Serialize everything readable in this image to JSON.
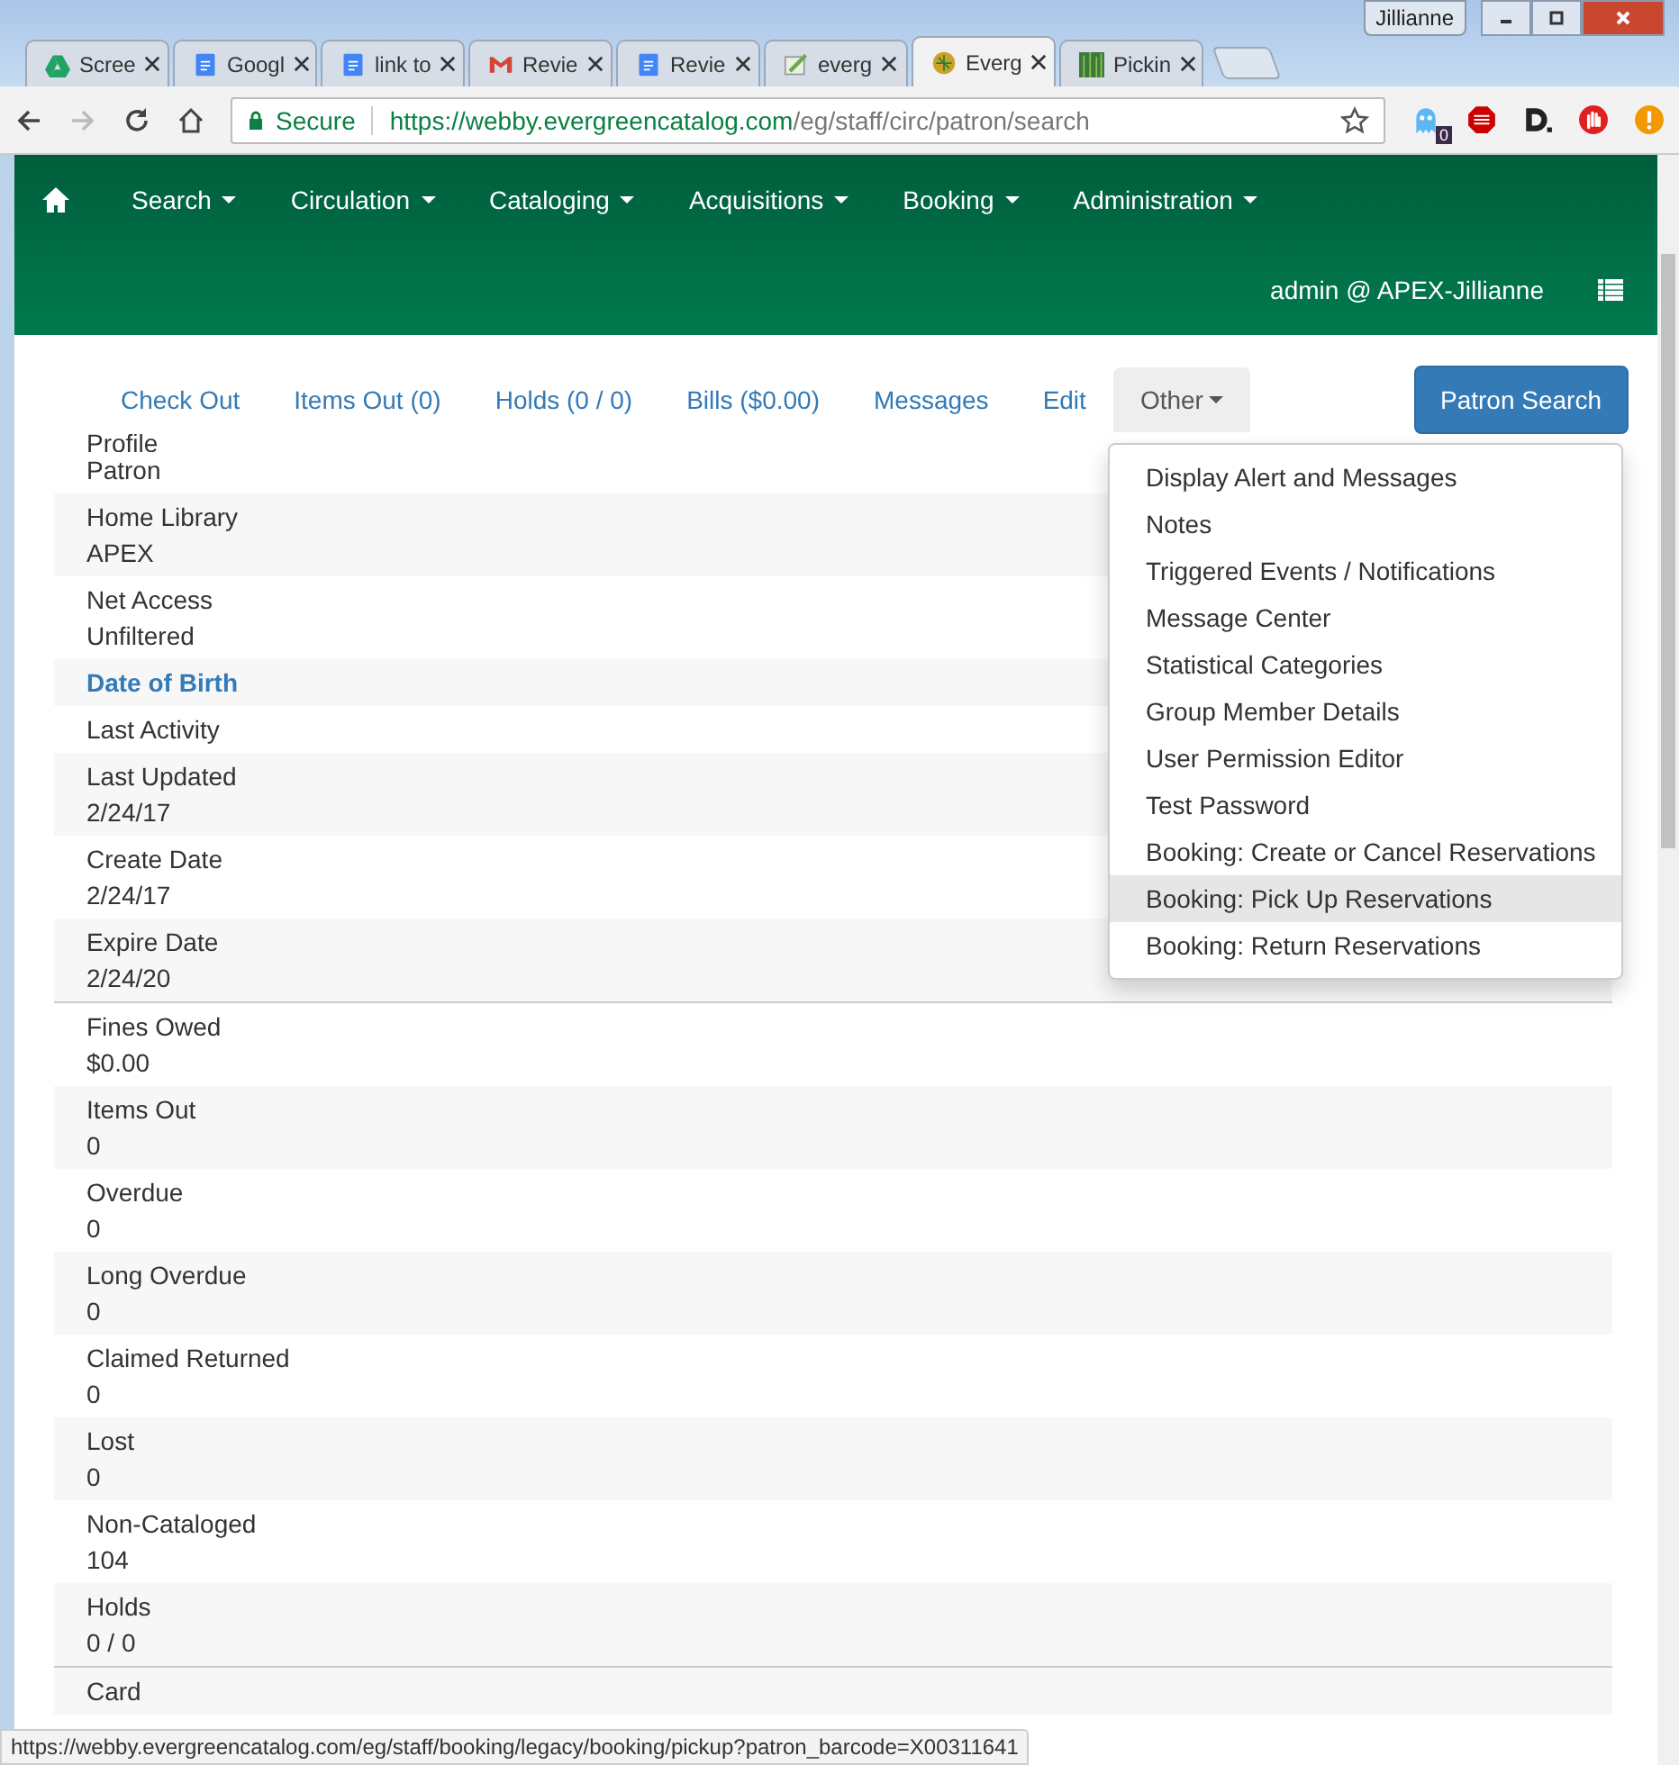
{
  "browser": {
    "profile": "Jillianne",
    "tabs": [
      {
        "title": "Scree",
        "selected": false
      },
      {
        "title": "Googl",
        "selected": false
      },
      {
        "title": "link to",
        "selected": false
      },
      {
        "title": "Revie",
        "selected": false
      },
      {
        "title": "Revie",
        "selected": false
      },
      {
        "title": "everg",
        "selected": false
      },
      {
        "title": "Everg",
        "selected": true
      },
      {
        "title": "Pickin",
        "selected": false
      }
    ],
    "security": "Secure",
    "url_host": "https://webby.evergreencatalog.com",
    "url_path": "/eg/staff/circ/patron/search",
    "extension_badge": "0"
  },
  "nav": {
    "items": [
      "Search",
      "Circulation",
      "Cataloging",
      "Acquisitions",
      "Booking",
      "Administration"
    ],
    "user": "admin @ APEX-Jillianne"
  },
  "patron_tabs": [
    {
      "label": "Check Out",
      "selected": false
    },
    {
      "label": "Items Out (0)",
      "selected": false
    },
    {
      "label": "Holds (0 / 0)",
      "selected": false
    },
    {
      "label": "Bills ($0.00)",
      "selected": false
    },
    {
      "label": "Messages",
      "selected": false
    },
    {
      "label": "Edit",
      "selected": false
    },
    {
      "label": "Other",
      "selected": true,
      "kind": "dropdown"
    }
  ],
  "search_button": "Patron Search",
  "summary_groups": [
    [
      {
        "label": "Profile",
        "value": "Patron",
        "kind": "field"
      },
      {
        "label": "Home Library",
        "value": "APEX",
        "kind": "field"
      },
      {
        "label": "Net Access",
        "value": "Unfiltered",
        "kind": "field"
      },
      {
        "label": "Date of Birth",
        "kind": "link"
      },
      {
        "label": "Last Activity",
        "kind": "field"
      },
      {
        "label": "Last Updated",
        "value": "2/24/17",
        "kind": "field"
      },
      {
        "label": "Create Date",
        "value": "2/24/17",
        "kind": "field"
      },
      {
        "label": "Expire Date",
        "value": "2/24/20",
        "kind": "field"
      }
    ],
    [
      {
        "label": "Fines Owed",
        "value": "$0.00",
        "kind": "field"
      },
      {
        "label": "Items Out",
        "value": "0",
        "kind": "field"
      },
      {
        "label": "Overdue",
        "value": "0",
        "kind": "field"
      },
      {
        "label": "Long Overdue",
        "value": "0",
        "kind": "field"
      },
      {
        "label": "Claimed Returned",
        "value": "0",
        "kind": "field"
      },
      {
        "label": "Lost",
        "value": "0",
        "kind": "field"
      },
      {
        "label": "Non-Cataloged",
        "value": "104",
        "kind": "field"
      },
      {
        "label": "Holds",
        "value": "0 / 0",
        "kind": "field"
      }
    ],
    [
      {
        "label": "Card",
        "kind": "field"
      }
    ]
  ],
  "other_menu": [
    {
      "label": "Display Alert and Messages",
      "selected": false
    },
    {
      "label": "Notes",
      "selected": false
    },
    {
      "label": "Triggered Events / Notifications",
      "selected": false
    },
    {
      "label": "Message Center",
      "selected": false
    },
    {
      "label": "Statistical Categories",
      "selected": false
    },
    {
      "label": "Group Member Details",
      "selected": false
    },
    {
      "label": "User Permission Editor",
      "selected": false
    },
    {
      "label": "Test Password",
      "selected": false
    },
    {
      "label": "Booking: Create or Cancel Reservations",
      "selected": false
    },
    {
      "label": "Booking: Pick Up Reservations",
      "selected": true
    },
    {
      "label": "Booking: Return Reservations",
      "selected": false
    }
  ],
  "status_bar": "https://webby.evergreencatalog.com/eg/staff/booking/legacy/booking/pickup?patron_barcode=X00311641"
}
